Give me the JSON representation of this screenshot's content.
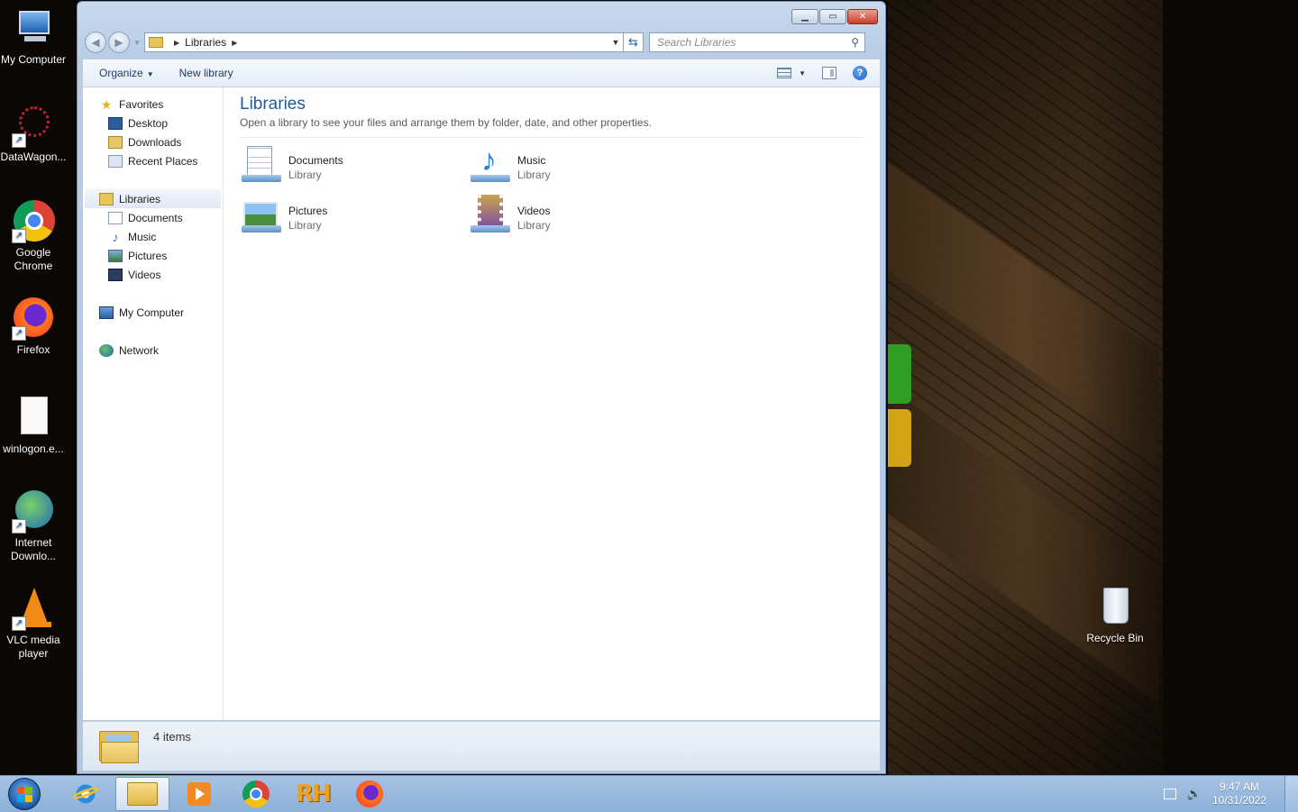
{
  "desktop": {
    "icons_left": [
      {
        "label": "My Computer",
        "icon": "computer-icon"
      },
      {
        "label": "DataWagon...",
        "icon": "datawagon-icon"
      },
      {
        "label": "Google Chrome",
        "icon": "chrome-icon"
      },
      {
        "label": "Firefox",
        "icon": "firefox-icon"
      },
      {
        "label": "winlogon.e...",
        "icon": "file-icon"
      },
      {
        "label": "Internet Downlo...",
        "icon": "idm-icon"
      },
      {
        "label": "VLC media player",
        "icon": "vlc-icon"
      }
    ],
    "recycle_bin": {
      "label": "Recycle Bin",
      "icon": "recycle-bin-icon"
    }
  },
  "window": {
    "address": {
      "segment": "Libraries"
    },
    "search": {
      "placeholder": "Search Libraries"
    },
    "command_bar": {
      "organize": "Organize",
      "new_library": "New library"
    },
    "nav": {
      "favorites": "Favorites",
      "favorites_items": [
        "Desktop",
        "Downloads",
        "Recent Places"
      ],
      "libraries": "Libraries",
      "libraries_items": [
        "Documents",
        "Music",
        "Pictures",
        "Videos"
      ],
      "computer": "My Computer",
      "network": "Network"
    },
    "content": {
      "title": "Libraries",
      "subtitle": "Open a library to see your files and arrange them by folder, date, and other properties.",
      "items": [
        {
          "name": "Documents",
          "type": "Library",
          "icon": "documents-library-icon"
        },
        {
          "name": "Music",
          "type": "Library",
          "icon": "music-library-icon"
        },
        {
          "name": "Pictures",
          "type": "Library",
          "icon": "pictures-library-icon"
        },
        {
          "name": "Videos",
          "type": "Library",
          "icon": "videos-library-icon"
        }
      ]
    },
    "status": {
      "count": "4 items"
    }
  },
  "taskbar": {
    "clock": {
      "time": "9:47 AM",
      "date": "10/31/2022"
    },
    "pinned": [
      "internet-explorer-icon",
      "windows-explorer-icon",
      "media-player-icon",
      "chrome-icon",
      "rh-icon",
      "firefox-icon"
    ],
    "active": "windows-explorer-icon"
  },
  "colors": {
    "title_blue": "#1e5a9a",
    "taskbar": "#8cb0d9",
    "wallpaper": "#0a0705"
  }
}
